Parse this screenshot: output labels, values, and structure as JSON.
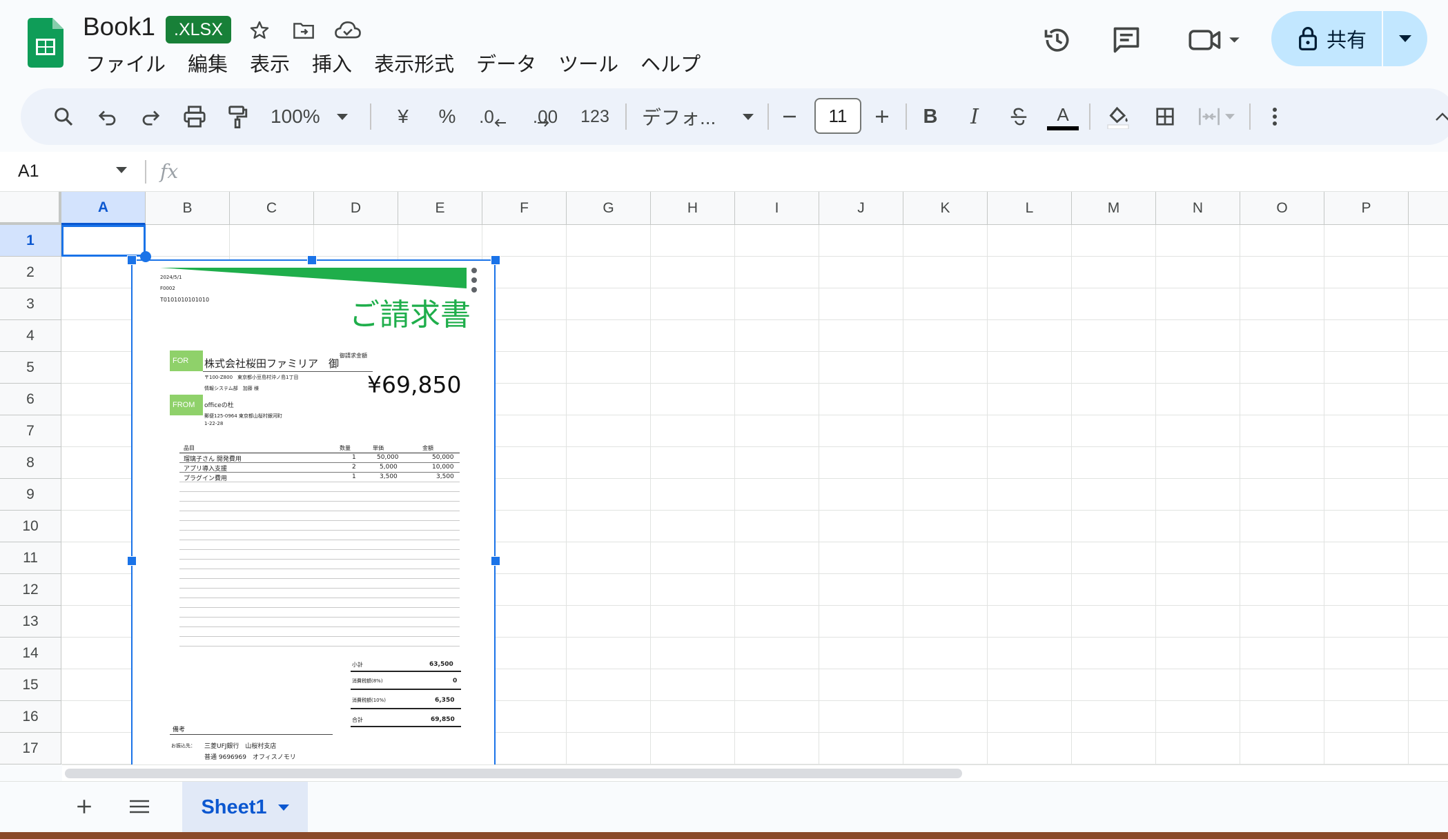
{
  "header": {
    "title": "Book1",
    "badge": ".XLSX",
    "menu": [
      "ファイル",
      "編集",
      "表示",
      "挿入",
      "表示形式",
      "データ",
      "ツール",
      "ヘルプ"
    ],
    "share_label": "共有"
  },
  "toolbar": {
    "zoom": "100%",
    "currency": "¥",
    "percent": "%",
    "dec_decrease": ".0",
    "dec_increase": ".00",
    "number_format": "123",
    "font": "デフォ...",
    "font_size": "11",
    "bold": "B",
    "italic": "I",
    "text_color_letter": "A"
  },
  "formula_bar": {
    "cell_ref": "A1",
    "fx": "fx"
  },
  "grid": {
    "columns": [
      "A",
      "B",
      "C",
      "D",
      "E",
      "F",
      "G",
      "H",
      "I",
      "J",
      "K",
      "L",
      "M",
      "N",
      "O",
      "P"
    ],
    "rows": [
      "1",
      "2",
      "3",
      "4",
      "5",
      "6",
      "7",
      "8",
      "9",
      "10",
      "11",
      "12",
      "13",
      "14",
      "15",
      "16",
      "17"
    ],
    "selected_cell": "A1"
  },
  "invoice": {
    "date": "2024/5/1",
    "number": "F0002",
    "reg_no": "T0101010101010",
    "title": "ご請求書",
    "for_label": "FOR",
    "client": "株式会社桜田ファミリア　御",
    "client_addr": "〒100-Z800　東京都小豆島村沖ノ島1丁目",
    "client_dept": "情報システム部　加藤 様",
    "from_label": "FROM",
    "sender": "officeの杜",
    "sender_addr": "郵便125-0964 東京都山桜村銀河町",
    "sender_addr2": "1-22-28",
    "amount_label": "御請求金額",
    "amount": "¥69,850",
    "table_headers": [
      "品目",
      "数量",
      "単価",
      "金額"
    ],
    "items": [
      {
        "name": "瑠璃子さん 開発費用",
        "qty": "1",
        "price": "50,000",
        "amount": "50,000"
      },
      {
        "name": "アプリ導入支援",
        "qty": "2",
        "price": "5,000",
        "amount": "10,000"
      },
      {
        "name": "プラグイン費用",
        "qty": "1",
        "price": "3,500",
        "amount": "3,500"
      }
    ],
    "subtotal_label": "小計",
    "subtotal": "63,500",
    "tax8_label": "消費税額(8%)",
    "tax8": "0",
    "tax10_label": "消費税額(10%)",
    "tax10": "6,350",
    "total_label": "合計",
    "total": "69,850",
    "notes_label": "備考",
    "bank_label": "お振込先：",
    "bank": "三菱UFJ銀行　山桜村支店",
    "account": "普通 9696969　オフィスノモリ"
  },
  "sheets": {
    "active": "Sheet1"
  },
  "colors": {
    "accent": "#0b57d0",
    "brand_green": "#188038",
    "invoice_green": "#1fae4b"
  }
}
